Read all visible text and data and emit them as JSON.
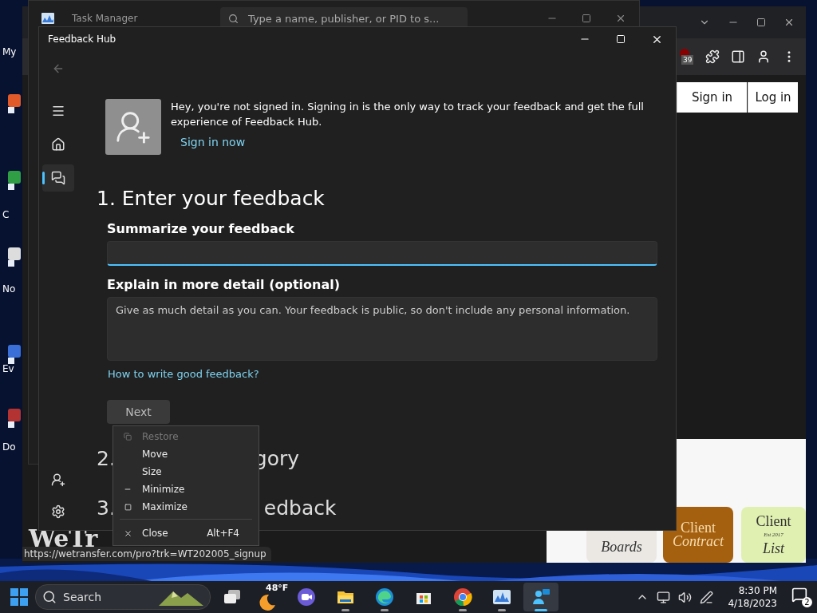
{
  "desktop_icons": [
    {
      "label": "My"
    },
    {
      "label": "C"
    },
    {
      "label": "No"
    },
    {
      "label": "Ev"
    },
    {
      "label": "Do"
    }
  ],
  "browser": {
    "extension_badge": "39",
    "buttons": [
      "Sign in",
      "Log in"
    ],
    "logo": "WeTr",
    "cards": [
      {
        "lines": [
          "Boards"
        ],
        "color": "#ebe8e4"
      },
      {
        "lines": [
          "Client",
          "Contract"
        ],
        "color": "#a5600f"
      },
      {
        "lines": [
          "Client",
          "Est 2017",
          "List"
        ],
        "color": "#e0f0b0"
      }
    ],
    "status_url": "https://wetransfer.com/pro?trk=WT202005_signup"
  },
  "task_manager": {
    "title": "Task Manager",
    "search": {
      "placeholder": "Type a name, publisher, or PID to s..."
    }
  },
  "feedback_hub": {
    "title": "Feedback Hub",
    "nav": [
      {
        "kind": "menu",
        "selected": false
      },
      {
        "kind": "home",
        "selected": false
      },
      {
        "kind": "feedback",
        "selected": true
      }
    ],
    "bottom_nav": [
      {
        "kind": "add-user"
      },
      {
        "kind": "settings"
      }
    ],
    "banner": {
      "text": "Hey, you're not signed in. Signing in is the only way to track your feedback and get the full experience of Feedback Hub.",
      "link": "Sign in now"
    },
    "heading": "1. Enter your feedback",
    "summary": {
      "label": "Summarize your feedback",
      "focused": true
    },
    "detail": {
      "label": "Explain in more detail (optional)",
      "placeholder": "Give as much detail as you can. Your feedback is public, so don't include any personal information."
    },
    "help_link": "How to write good feedback?",
    "next": {
      "label": "Next",
      "disabled": true
    },
    "steps": [
      {
        "number": "2.",
        "tail": "gory"
      },
      {
        "number": "3.",
        "tail": "edback"
      }
    ]
  },
  "context_menu": {
    "items": [
      {
        "kind": "restore",
        "label": "Restore",
        "disabled": true
      },
      {
        "kind": "plain",
        "label": "Move",
        "disabled": false
      },
      {
        "kind": "plain",
        "label": "Size",
        "disabled": false
      },
      {
        "kind": "minimize",
        "label": "Minimize",
        "disabled": false
      },
      {
        "kind": "maximize",
        "label": "Maximize",
        "disabled": false
      },
      {
        "kind": "separator"
      },
      {
        "kind": "close",
        "label": "Close",
        "shortcut": "Alt+F4",
        "disabled": false
      }
    ]
  },
  "taskbar": {
    "search": "Search",
    "weather": "48°F",
    "apps": [
      {
        "kind": "task-view",
        "running": false,
        "selected": false
      },
      {
        "kind": "teams",
        "running": false,
        "selected": false
      },
      {
        "kind": "explorer",
        "running": true,
        "selected": false
      },
      {
        "kind": "edge",
        "running": true,
        "selected": false
      },
      {
        "kind": "store",
        "running": false,
        "selected": false
      },
      {
        "kind": "chrome",
        "running": true,
        "selected": false
      },
      {
        "kind": "task-manager",
        "running": true,
        "selected": false
      },
      {
        "kind": "feedback-hub",
        "running": true,
        "selected": true
      }
    ],
    "time": "8:30 PM",
    "date": "4/18/2023",
    "notifications": "2"
  }
}
